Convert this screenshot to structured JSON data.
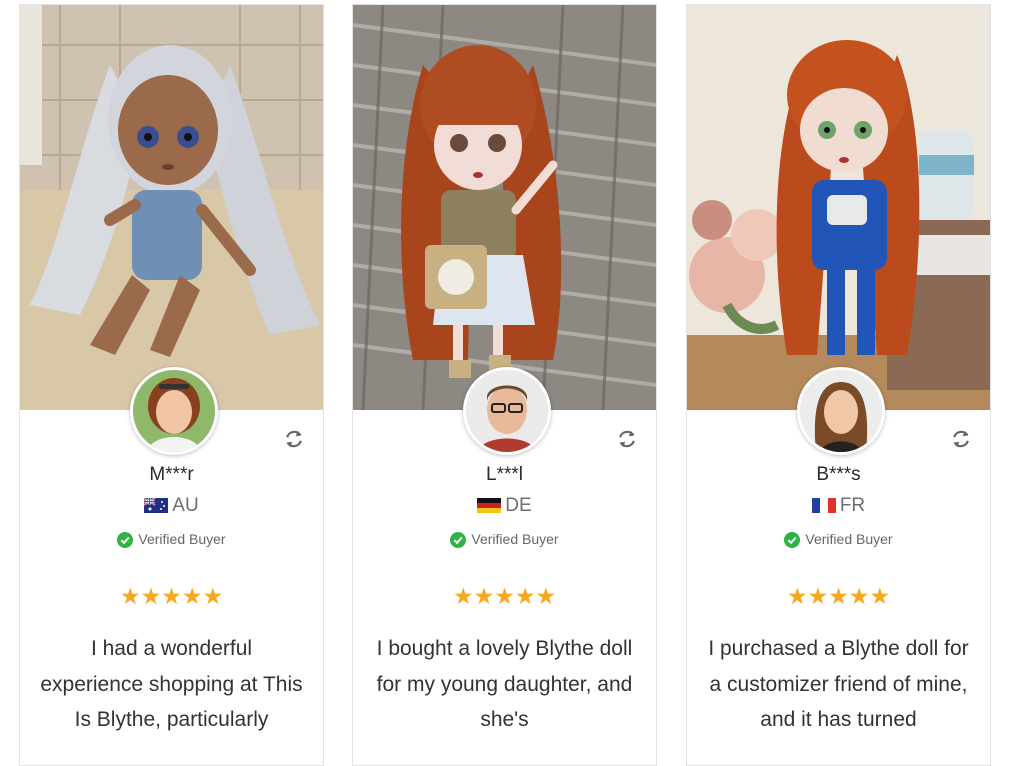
{
  "reviews": [
    {
      "name": "M***r",
      "country": "AU",
      "verified": "Verified Buyer",
      "rating": 5,
      "text": "I had a wonderful experience shopping at This Is Blythe, particularly"
    },
    {
      "name": "L***l",
      "country": "DE",
      "verified": "Verified Buyer",
      "rating": 5,
      "text": "I bought a lovely Blythe doll for my young daughter, and she's"
    },
    {
      "name": "B***s",
      "country": "FR",
      "verified": "Verified Buyer",
      "rating": 5,
      "text": "I purchased a Blythe doll for a customizer friend of mine, and it has turned"
    }
  ],
  "icons": {
    "refresh": "refresh-icon",
    "verified": "check-circle-icon",
    "star": "star-icon"
  },
  "colors": {
    "star": "#f6a821",
    "verified_check": "#2fb344",
    "text_muted": "#6b6f74"
  }
}
